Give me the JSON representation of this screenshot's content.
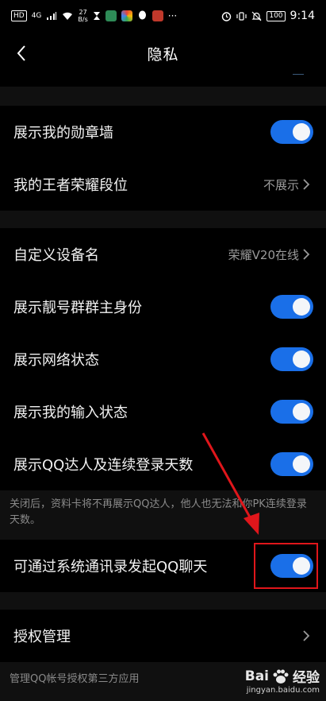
{
  "status_bar": {
    "left": [
      "HD",
      "4G",
      "27",
      "B/s"
    ],
    "battery": "100",
    "time": "9:14",
    "icons": [
      "signal-icon",
      "wifi-icon",
      "hourglass-icon",
      "app-icon",
      "app-icon",
      "qq-icon",
      "app-icon",
      "more-icon",
      "alarm-icon",
      "vibrate-icon",
      "mute-icon",
      "battery-icon"
    ]
  },
  "nav": {
    "title": "隐私"
  },
  "sections": {
    "s1": [
      {
        "label": "展示我的勋章墙"
      },
      {
        "label": "我的王者荣耀段位",
        "value": "不展示"
      }
    ],
    "s2": [
      {
        "label": "自定义设备名",
        "value": "荣耀V20在线"
      },
      {
        "label": "展示靓号群群主身份"
      },
      {
        "label": "展示网络状态"
      },
      {
        "label": "展示我的输入状态"
      },
      {
        "label": "展示QQ达人及连续登录天数"
      }
    ],
    "note1": "关闭后，资料卡将不再展示QQ达人，他人也无法和你PK连续登录天数。",
    "s3": [
      {
        "label": "可通过系统通讯录发起QQ聊天"
      }
    ],
    "s4": [
      {
        "label": "授权管理"
      }
    ],
    "note2": "管理QQ帐号授权第三方应用"
  },
  "watermark": {
    "brand": "Bai",
    "brand2": "经验",
    "site": "jingyan.baidu.com"
  },
  "colors": {
    "toggle_on": "#1a6fe8",
    "annotation": "#e0161b"
  }
}
